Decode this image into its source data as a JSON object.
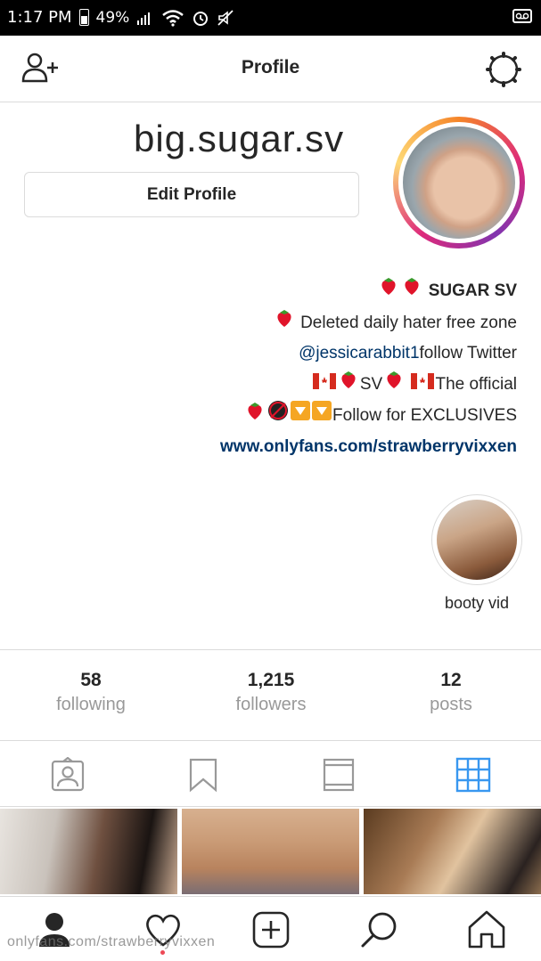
{
  "status_bar": {
    "time": "1:17 PM",
    "battery": "49%"
  },
  "topbar": {
    "title": "Profile"
  },
  "profile": {
    "username": "big.sugar.sv",
    "edit_button": "Edit Profile"
  },
  "bio": {
    "name": "SUGAR SV",
    "line1": "Deleted daily hater free zone",
    "line2_prefix": "follow Twitter ",
    "line2_mention": "@jessicarabbit1",
    "line3_a": "The official",
    "line3_b": "SV",
    "line4": "Follow for EXCLUSIVES",
    "link": "www.onlyfans.com/strawberryvixxen"
  },
  "highlight": {
    "label": "booty vid"
  },
  "stats": {
    "posts_count": "12",
    "posts_label": "posts",
    "followers_count": "1,215",
    "followers_label": "followers",
    "following_count": "58",
    "following_label": "following"
  },
  "watermark": "onlyfans.com/strawberryvixxen",
  "colors": {
    "accent_blue": "#3897f0",
    "link_blue": "#003569",
    "text": "#262626",
    "muted": "#999999",
    "notification_dot": "#ed4956"
  },
  "icons": {
    "topbar_left": "add-user-icon",
    "topbar_right": "settings-gear-icon",
    "tabs": [
      "tagged-photos-icon",
      "saved-bookmark-icon",
      "list-view-icon",
      "grid-view-icon"
    ],
    "nav": [
      "profile-icon",
      "activity-heart-icon",
      "new-post-icon",
      "search-icon",
      "home-icon"
    ]
  }
}
